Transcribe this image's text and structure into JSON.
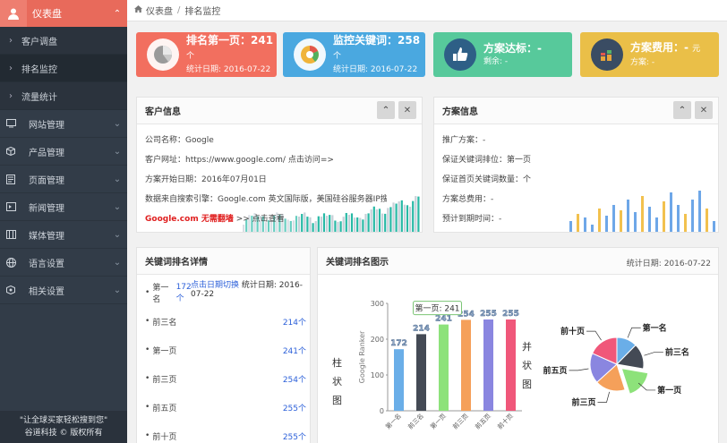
{
  "sidebar": {
    "dashboard": "仪表盘",
    "subitems": [
      "客户调盘",
      "排名监控",
      "流量统计"
    ],
    "menus": [
      {
        "label": "网站管理",
        "icon": "monitor-icon"
      },
      {
        "label": "产品管理",
        "icon": "box-icon"
      },
      {
        "label": "页面管理",
        "icon": "page-icon"
      },
      {
        "label": "新闻管理",
        "icon": "news-icon"
      },
      {
        "label": "媒体管理",
        "icon": "media-icon"
      },
      {
        "label": "语言设置",
        "icon": "globe-icon"
      },
      {
        "label": "相关设置",
        "icon": "settings-icon"
      }
    ],
    "footer_slogan": "\"让全球买家轻松搜到您\"",
    "footer_copy": "谷道科技 © 版权所有"
  },
  "breadcrumb": {
    "home": "仪表盘",
    "current": "排名监控"
  },
  "stats": [
    {
      "title": "排名第一页：241",
      "unit": "个",
      "sub": "统计日期: 2016-07-22",
      "color": "#f26f5f"
    },
    {
      "title": "监控关键词：258",
      "unit": "个",
      "sub": "统计日期: 2016-07-22",
      "color": "#4aa8e0"
    },
    {
      "title": "方案达标：-",
      "unit": "",
      "sub": "剩余: -",
      "color": "#57c99b"
    },
    {
      "title": "方案费用：-",
      "unit": "元",
      "sub": "方案: -",
      "color": "#eabf48"
    }
  ],
  "customer": {
    "title": "客户信息",
    "company": "公司名称：Google",
    "url": "客户网址：https://www.google.com/ 点击访问=>",
    "start": "方案开始日期：2016年07月01日",
    "source": "数据来自搜索引擎：Google.com 英文国际版，美国硅谷服务器IP搜索结果为准",
    "link_red": "Google.com 无需翻墙",
    "link_tail": ">> 点击查看"
  },
  "plan": {
    "title": "方案信息",
    "rows": [
      "推广方案：-",
      "保证关键词排位：第一页",
      "保证首页关键词数量：个",
      "方案总费用：-",
      "预计到期时间：-"
    ]
  },
  "keywords": {
    "title": "关键词排名详情",
    "switch": "点击日期切换",
    "date": "统计日期: 2016-07-22",
    "rows": [
      {
        "label": "第一名",
        "value": "172个"
      },
      {
        "label": "前三名",
        "value": "214个"
      },
      {
        "label": "第一页",
        "value": "241个"
      },
      {
        "label": "前三页",
        "value": "254个"
      },
      {
        "label": "前五页",
        "value": "255个"
      },
      {
        "label": "前十页",
        "value": "255个"
      }
    ]
  },
  "ranking": {
    "title": "关键词排名图示",
    "date": "统计日期: 2016-07-22",
    "bar_left_label": "柱状图",
    "bar_right_label": "并状图",
    "tooltip": "第一页: 241"
  },
  "chart_data": [
    {
      "type": "bar",
      "categories": [
        "第一名",
        "前三名",
        "第一页",
        "前三页",
        "前五页",
        "前十页"
      ],
      "values": [
        172,
        214,
        241,
        254,
        255,
        255
      ],
      "ylabel": "Google Ranker",
      "ylim": [
        0,
        300
      ],
      "yticks": [
        0,
        100,
        200,
        300
      ],
      "colors": [
        "#6aaee8",
        "#444a55",
        "#8de27a",
        "#f5a05a",
        "#8a86e0",
        "#f0577a"
      ]
    },
    {
      "type": "pie",
      "categories": [
        "第一名",
        "前三名",
        "第一页",
        "前三页",
        "前五页",
        "前十页"
      ],
      "values": [
        172,
        214,
        241,
        254,
        255,
        255
      ],
      "colors": [
        "#6aaee8",
        "#444a55",
        "#8de27a",
        "#f5a05a",
        "#8a86e0",
        "#f0577a"
      ]
    }
  ]
}
